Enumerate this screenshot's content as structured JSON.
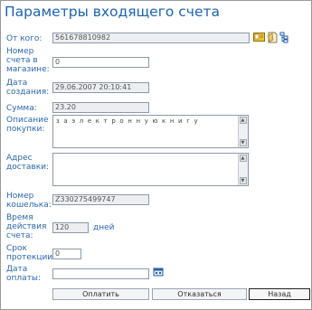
{
  "page": {
    "title": "Параметры входящего счета"
  },
  "fields": {
    "from": {
      "label": "От кого:",
      "value": "561678810982"
    },
    "invoice_number": {
      "label_lines": [
        "Номер",
        "счета в",
        "магазине:"
      ],
      "value": "0"
    },
    "created": {
      "label_lines": [
        "Дата",
        "создания:"
      ],
      "value": "29.06.2007 20:10:41"
    },
    "amount": {
      "label": "Сумма:",
      "value": "23.20"
    },
    "description": {
      "label_lines": [
        "Описание",
        "покупки:"
      ],
      "value": "з а  э л е к т р о н н у ю  к н и г у"
    },
    "address": {
      "label_lines": [
        "Адрес",
        "доставки:"
      ],
      "value": ""
    },
    "wallet": {
      "label_lines": [
        "Номер",
        "кошелька:"
      ],
      "value": "Z330275499747"
    },
    "validity": {
      "label_lines": [
        "Время",
        "действия",
        "счета:"
      ],
      "value": "120",
      "suffix": "дней"
    },
    "protection": {
      "label_lines": [
        "Срок",
        "протекции:"
      ],
      "value": "0"
    },
    "pay_date": {
      "label_lines": [
        "Дата",
        "оплаты:"
      ],
      "value": ""
    }
  },
  "buttons": {
    "pay": "Оплатить",
    "refuse": "Отказаться",
    "back": "Назад"
  },
  "icons": [
    "contact-card-icon",
    "note-icon",
    "tree-icon",
    "calendar-icon"
  ],
  "colors": {
    "accent": "#1b63b5",
    "label": "#2a66b0",
    "field_border": "#8d98a8"
  }
}
